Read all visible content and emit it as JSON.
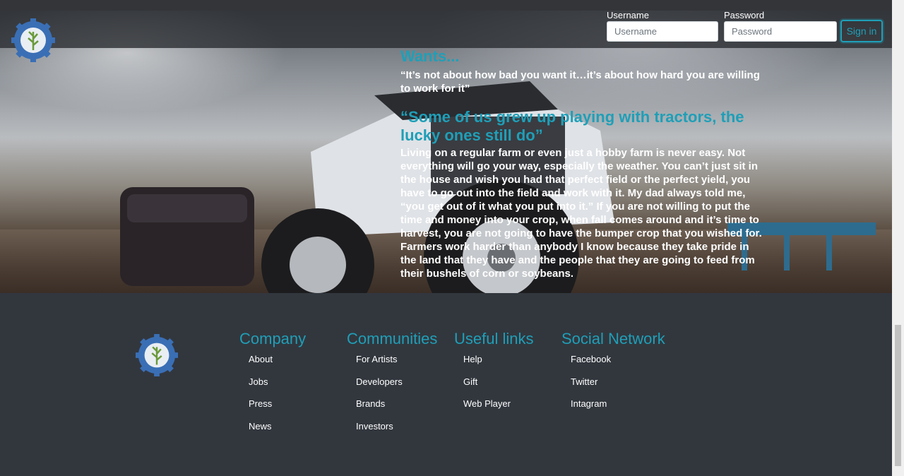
{
  "nav": {
    "username_label": "Username",
    "username_placeholder": "Username",
    "password_label": "Password",
    "password_placeholder": "Password",
    "signin_label": "Sign in"
  },
  "content": {
    "heading1": "Wants...",
    "quote1": "“It’s not about how bad you want it…it’s about how hard you are willing to work for it”",
    "heading2": "“Some of us grew up playing with tractors, the lucky ones still do”",
    "paragraph": "Living on a regular farm or even just a hobby farm is never easy. Not everything will go your way, especially the weather. You can’t just sit in the house and wish you had that perfect field or the perfect yield, you have to go out into the field and work with it. My dad always told me, “you get out of it what you put into it.” If you are not willing to put the time and money into your crop, when fall comes around and it’s time to harvest, you are not going to have the bumper crop that you wished for. Farmers work harder than anybody I know because they take pride in the land that they have and the people that they are going to feed from their bushels of corn or soybeans."
  },
  "footer": {
    "columns": [
      {
        "title": "Company",
        "links": [
          "About",
          "Jobs",
          "Press",
          "News"
        ]
      },
      {
        "title": "Communities",
        "links": [
          "For Artists",
          "Developers",
          "Brands",
          "Investors"
        ]
      },
      {
        "title": "Useful links",
        "links": [
          "Help",
          "Gift",
          "Web Player"
        ]
      },
      {
        "title": "Social Network",
        "links": [
          "Facebook",
          "Twitter",
          "Intagram"
        ]
      }
    ]
  },
  "colors": {
    "accent": "#1f9fb8",
    "footer_bg": "#32373e",
    "logo_gear": "#3a6fb5"
  },
  "icons": {
    "logo": "gear-wheat-logo-icon"
  }
}
